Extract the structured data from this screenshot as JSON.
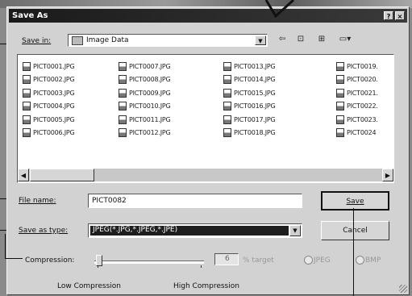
{
  "window": {
    "title": "Save As",
    "help_button": "?",
    "close_button": "×"
  },
  "save_in": {
    "label": "Save in:",
    "value": "Image Data"
  },
  "files": {
    "columns": [
      [
        "PICT0001.JPG",
        "PICT0002.JPG",
        "PICT0003.JPG",
        "PICT0004.JPG",
        "PICT0005.JPG",
        "PICT0006.JPG"
      ],
      [
        "PICT0007.JPG",
        "PICT0008.JPG",
        "PICT0009.JPG",
        "PICT0010.JPG",
        "PICT0011.JPG",
        "PICT0012.JPG"
      ],
      [
        "PICT0013.JPG",
        "PICT0014.JPG",
        "PICT0015.JPG",
        "PICT0016.JPG",
        "PICT0017.JPG",
        "PICT0018.JPG"
      ],
      [
        "PICT0019.",
        "PICT0020.",
        "PICT0021.",
        "PICT0022.",
        "PICT0023.",
        "PICT0024"
      ]
    ]
  },
  "file_name": {
    "label": "File name:",
    "value": "PICT0082"
  },
  "save_as_type": {
    "label": "Save as type:",
    "value": "JPEG(*.JPG,*.JPEG,*.JPE)"
  },
  "compression": {
    "label": "Compression:",
    "value": "6",
    "right_text": "% target",
    "option_1": "JPEG",
    "option_2": "BMP",
    "low_label": "Low Compression",
    "high_label": "High Compression"
  },
  "buttons": {
    "save": "Save",
    "cancel": "Cancel"
  },
  "colors": {
    "selection": "#1e1e1e",
    "titlebar": "#2a2a2a"
  }
}
